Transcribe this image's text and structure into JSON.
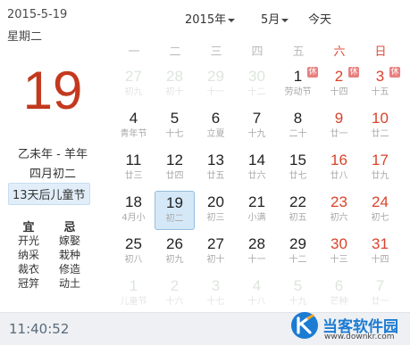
{
  "left": {
    "date": "2015-5-19",
    "weekday": "星期二",
    "big_day": "19",
    "ganzhi": "乙未年 - 羊年",
    "lunar": "四月初二",
    "countdown": "13天后儿童节",
    "yi_title": "宜",
    "ji_title": "忌",
    "yi_items": [
      "开光",
      "纳采",
      "裁衣",
      "冠笄"
    ],
    "ji_items": [
      "嫁娶",
      "栽种",
      "修造",
      "动土"
    ]
  },
  "nav": {
    "year": "2015年",
    "month": "5月",
    "today": "今天"
  },
  "weekdays": [
    "一",
    "二",
    "三",
    "四",
    "五",
    "六",
    "日"
  ],
  "weeks": [
    [
      {
        "d": "27",
        "s": "初九",
        "other": true
      },
      {
        "d": "28",
        "s": "初十",
        "other": true
      },
      {
        "d": "29",
        "s": "十一",
        "other": true
      },
      {
        "d": "30",
        "s": "十二",
        "other": true
      },
      {
        "d": "1",
        "s": "劳动节",
        "badge": "休"
      },
      {
        "d": "2",
        "s": "十四",
        "badge": "休"
      },
      {
        "d": "3",
        "s": "十五",
        "badge": "休"
      }
    ],
    [
      {
        "d": "4",
        "s": "青年节"
      },
      {
        "d": "5",
        "s": "十七"
      },
      {
        "d": "6",
        "s": "立夏"
      },
      {
        "d": "7",
        "s": "十九"
      },
      {
        "d": "8",
        "s": "二十"
      },
      {
        "d": "9",
        "s": "廿一"
      },
      {
        "d": "10",
        "s": "廿二"
      }
    ],
    [
      {
        "d": "11",
        "s": "廿三"
      },
      {
        "d": "12",
        "s": "廿四"
      },
      {
        "d": "13",
        "s": "廿五"
      },
      {
        "d": "14",
        "s": "廿六"
      },
      {
        "d": "15",
        "s": "廿七"
      },
      {
        "d": "16",
        "s": "廿八"
      },
      {
        "d": "17",
        "s": "廿九"
      }
    ],
    [
      {
        "d": "18",
        "s": "4月小"
      },
      {
        "d": "19",
        "s": "初二",
        "selected": true
      },
      {
        "d": "20",
        "s": "初三"
      },
      {
        "d": "21",
        "s": "小满"
      },
      {
        "d": "22",
        "s": "初五"
      },
      {
        "d": "23",
        "s": "初六"
      },
      {
        "d": "24",
        "s": "初七"
      }
    ],
    [
      {
        "d": "25",
        "s": "初八"
      },
      {
        "d": "26",
        "s": "初九"
      },
      {
        "d": "27",
        "s": "初十"
      },
      {
        "d": "28",
        "s": "十一"
      },
      {
        "d": "29",
        "s": "十二"
      },
      {
        "d": "30",
        "s": "十三"
      },
      {
        "d": "31",
        "s": "十四"
      }
    ],
    [
      {
        "d": "1",
        "s": "儿童节",
        "other": true
      },
      {
        "d": "2",
        "s": "十六",
        "other": true
      },
      {
        "d": "3",
        "s": "十七",
        "other": true
      },
      {
        "d": "4",
        "s": "十八",
        "other": true
      },
      {
        "d": "5",
        "s": "十九",
        "other": true
      },
      {
        "d": "6",
        "s": "芒种",
        "other": true
      },
      {
        "d": "7",
        "s": "廿一",
        "other": true
      }
    ]
  ],
  "bottom": {
    "time": "11:40:52"
  },
  "watermark": {
    "name": "当客软件园",
    "url": "www.downkr.com"
  },
  "colors": {
    "accent_red": "#c3391e",
    "weekend_red": "#d9432a",
    "holiday_badge": "#e8807f",
    "selected_bg": "#d5e8f7",
    "watermark_blue": "#1c7bd3"
  }
}
